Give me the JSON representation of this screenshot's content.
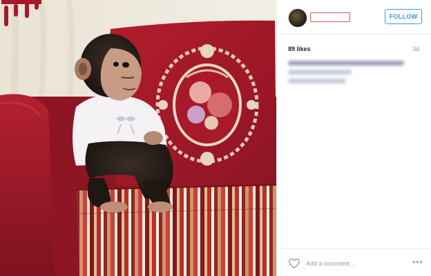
{
  "header": {
    "username": "",
    "follow_label": "FOLLOW"
  },
  "stats": {
    "likes": "89 likes",
    "time_ago": "3d"
  },
  "comment_box": {
    "placeholder": "Add a comment..."
  },
  "icons": {
    "heart": "heart-icon",
    "more": "more-options-icon"
  },
  "colors": {
    "follow_blue": "#3897f0",
    "redaction_red": "#d9534f",
    "sofa_red": "#a11a2a"
  }
}
